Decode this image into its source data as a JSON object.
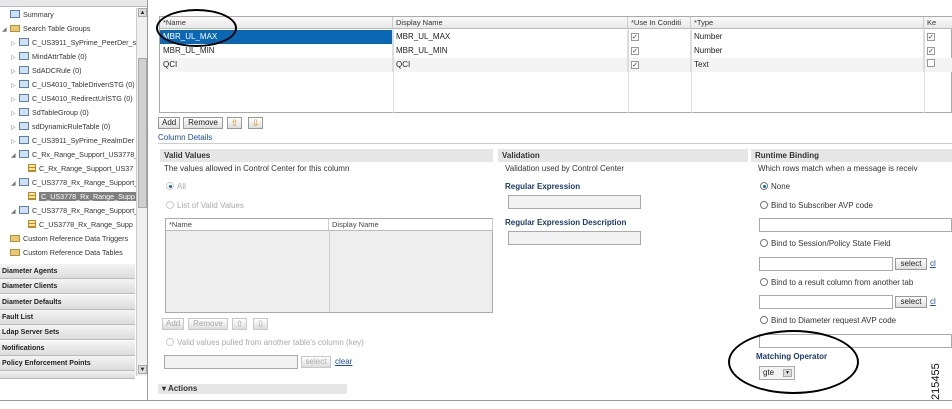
{
  "sidebar": {
    "tree": [
      {
        "label": "Summary",
        "icon": "table-group"
      },
      {
        "label": "Search Table Groups",
        "icon": "folder"
      },
      {
        "label": "C_US3911_SyPrime_PeerDer_s",
        "icon": "table-group"
      },
      {
        "label": "MindAttrTable (0)",
        "icon": "table-group"
      },
      {
        "label": "SdADCRule (0)",
        "icon": "table-group"
      },
      {
        "label": "C_US4010_TableDrivenSTG (0)",
        "icon": "table-group"
      },
      {
        "label": "C_US4010_RedirectUrlSTG (0)",
        "icon": "table-group"
      },
      {
        "label": "SdTableGroup (0)",
        "icon": "table-group"
      },
      {
        "label": "sdDynamicRuleTable (0)",
        "icon": "table-group"
      },
      {
        "label": "C_US3911_SyPrime_RealmDer",
        "icon": "table-group"
      },
      {
        "label": "C_Rx_Range_Support_US3778_",
        "icon": "table-group"
      },
      {
        "label": "C_Rx_Range_Support_US37",
        "icon": "table"
      },
      {
        "label": "C_US3778_Rx_Range_Support_",
        "icon": "table-group"
      },
      {
        "label": "C_US3778_Rx_Range_Supp",
        "icon": "table"
      },
      {
        "label": "C_US3778_Rx_Range_Support_",
        "icon": "table-group"
      },
      {
        "label": "C_US3778_Rx_Range_Supp",
        "icon": "table"
      },
      {
        "label": "Custom Reference Data Triggers",
        "icon": "folder"
      },
      {
        "label": "Custom Reference Data Tables",
        "icon": "folder"
      }
    ],
    "accordion": [
      "Diameter Agents",
      "Diameter Clients",
      "Diameter Defaults",
      "Fault List",
      "Ldap Server Sets",
      "Notifications",
      "Policy Enforcement Points"
    ]
  },
  "grid": {
    "headers": [
      "*Name",
      "Display Name",
      "*Use In Conditi",
      "*Type",
      "Ke"
    ],
    "rows": [
      {
        "name": "MBR_UL_MAX",
        "display": "MBR_UL_MAX",
        "use": "✓",
        "type": "Number",
        "key": "✓"
      },
      {
        "name": "MBR_UL_MIN",
        "display": "MBR_UL_MIN",
        "use": "✓",
        "type": "Number",
        "key": "✓"
      },
      {
        "name": "QCI",
        "display": "QCI",
        "use": "✓",
        "type": "Text",
        "key": ""
      }
    ]
  },
  "toolbar": {
    "add": "Add",
    "remove": "Remove"
  },
  "column_details": "Column Details",
  "valid_values": {
    "title": "Valid Values",
    "desc": "The values allowed in Control Center for this column",
    "opt_all": "All",
    "opt_list": "List of Valid Values",
    "col_name": "*Name",
    "col_display": "Display Name",
    "add": "Add",
    "remove": "Remove",
    "opt_pulled": "Valid values pulled from another table's column (key)",
    "select": "select",
    "clear": "clear"
  },
  "validation": {
    "title": "Validation",
    "desc": "Validation used by Control Center",
    "regex": "Regular Expression",
    "regex_desc": "Regular Expression Description"
  },
  "runtime": {
    "title": "Runtime Binding",
    "desc": "Which rows match when a message is receiv",
    "opt_none": "None",
    "opt_subscriber": "Bind to Subscriber AVP code",
    "opt_session": "Bind to Session/Policy State Field",
    "opt_result": "Bind to a result column from another tab",
    "opt_diameter": "Bind to Diameter request AVP code",
    "select": "select",
    "clear": "cl",
    "matching_operator": "Matching Operator",
    "operator_value": "gte"
  },
  "actions": "Actions",
  "figure_number": "215455"
}
